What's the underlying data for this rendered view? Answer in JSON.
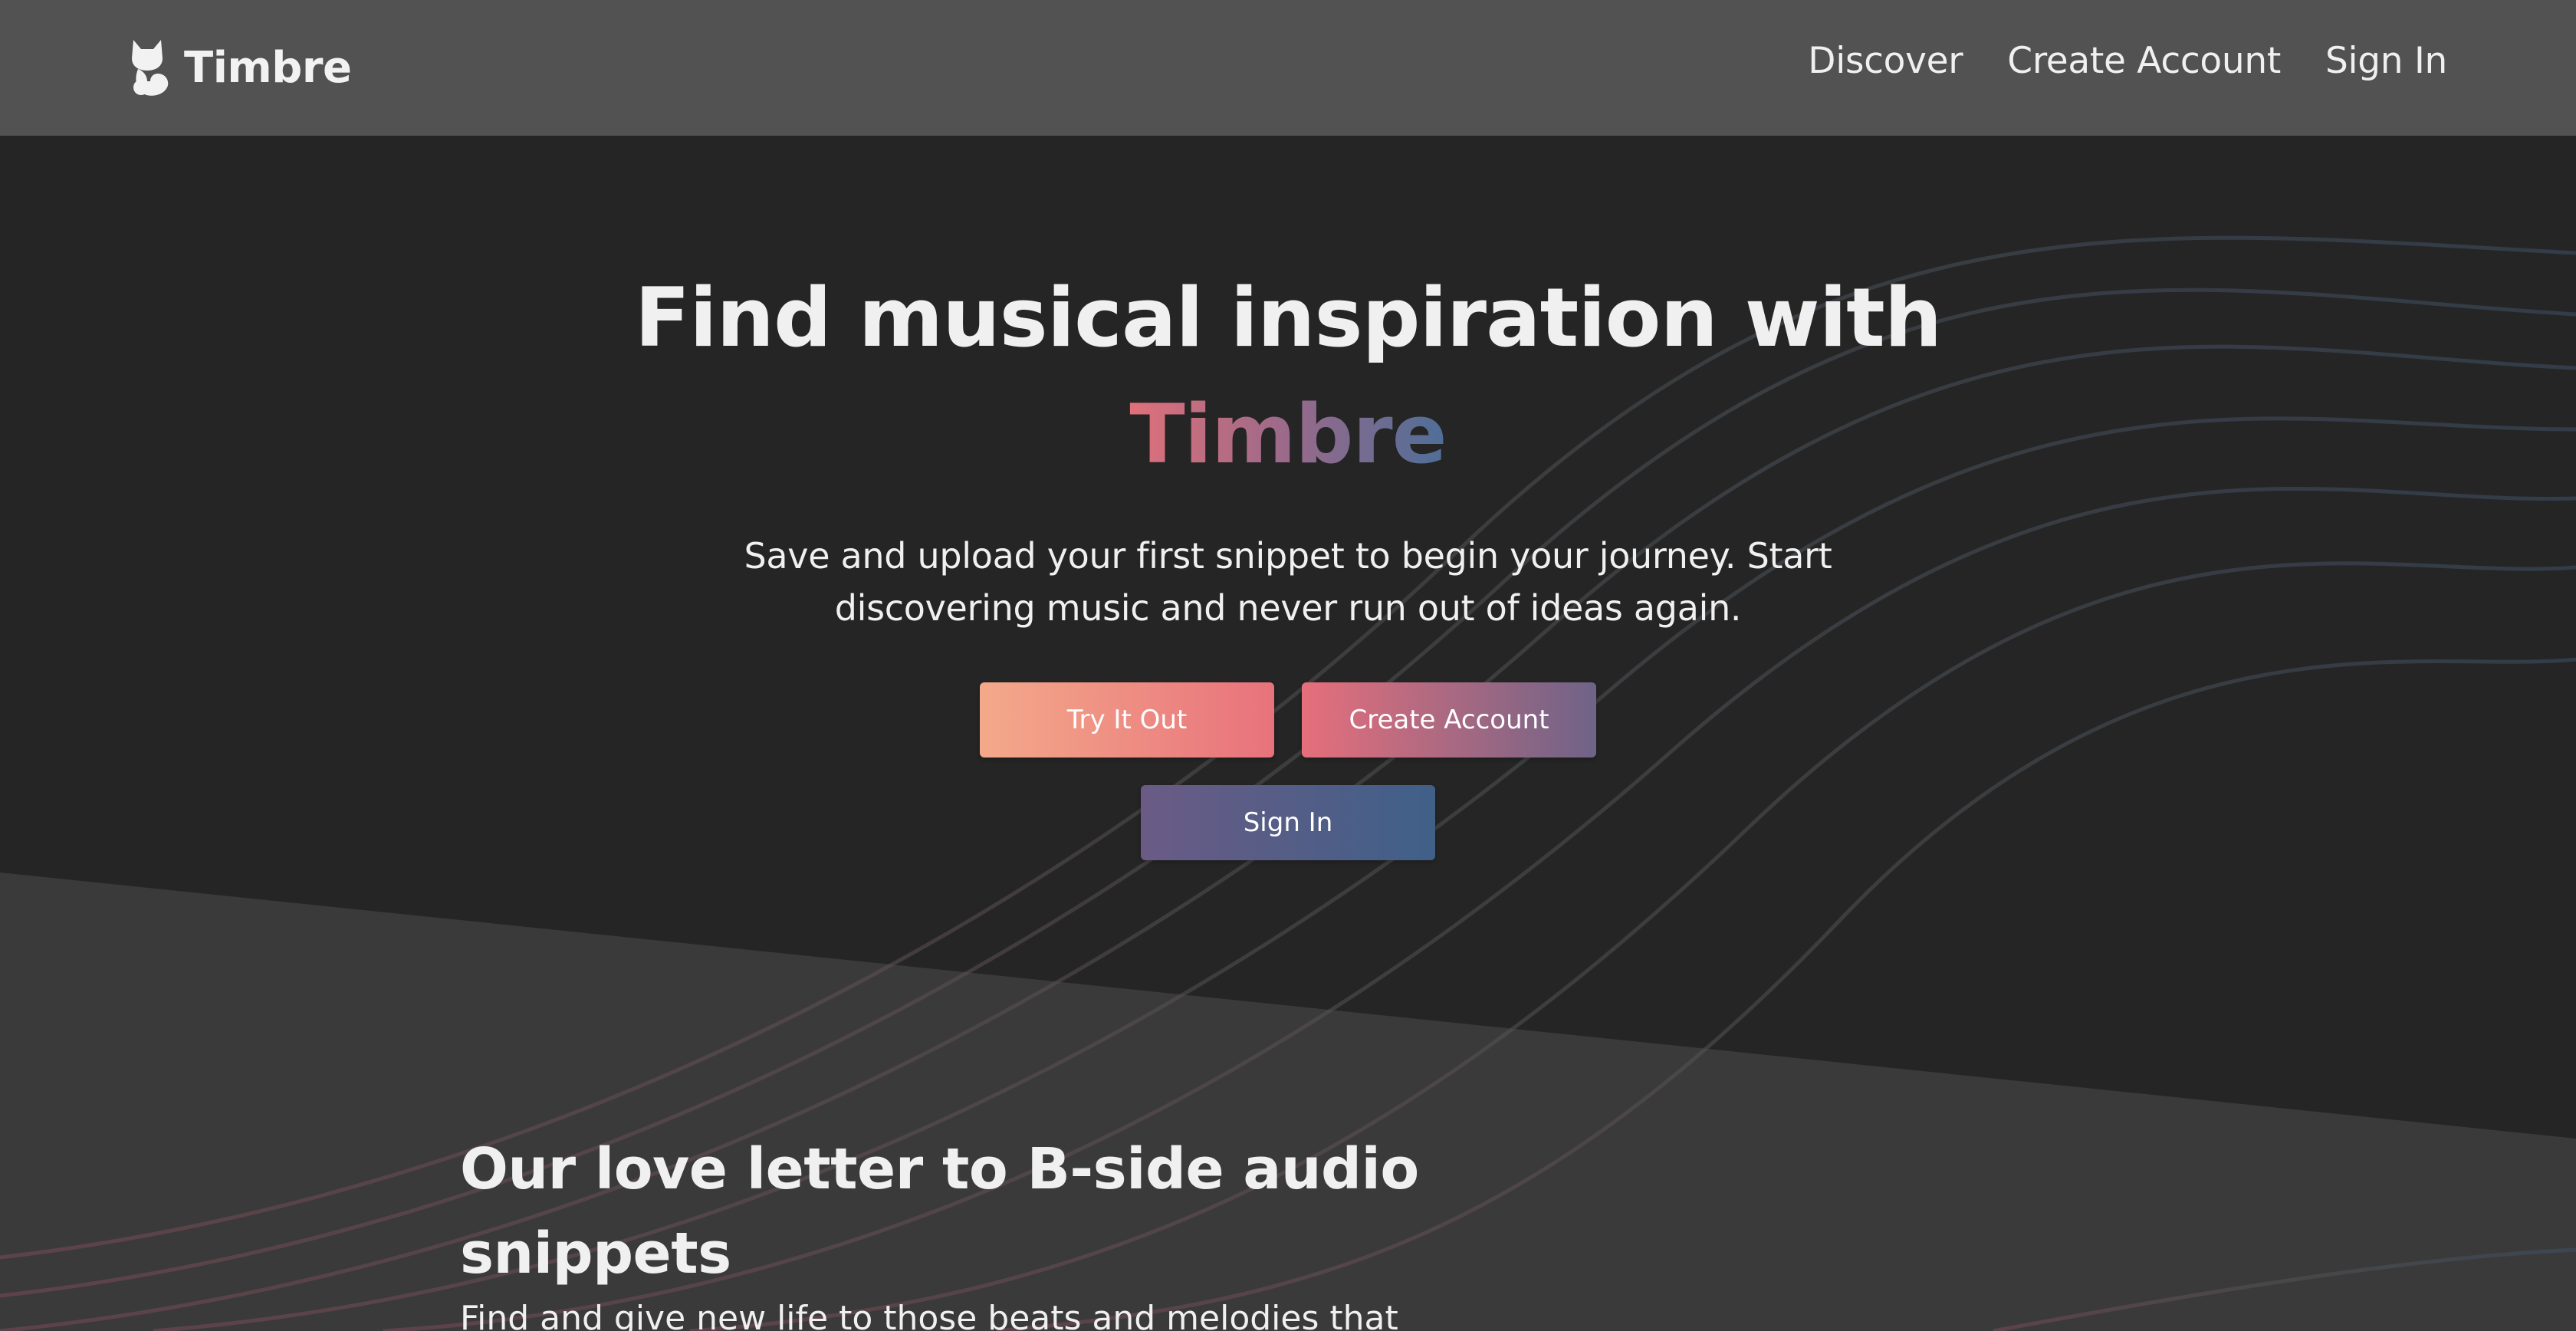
{
  "app": {
    "name": "Timbre"
  },
  "nav": {
    "brand_label": "Timbre",
    "logo_icon": "cat-music-note-icon",
    "links": [
      "Discover",
      "Create Account",
      "Sign In"
    ]
  },
  "hero": {
    "title_line1": "Find musical inspiration with",
    "title_brand": "Timbre",
    "subtitle_line1": "Save and upload your first snippet to begin your journey. Start",
    "subtitle_line2": "discovering music and never run out of ideas again.",
    "buttons": {
      "try": "Try It Out",
      "create": "Create Account",
      "signin": "Sign In"
    }
  },
  "section": {
    "title_line1": "Our love letter to B-side audio",
    "title_line2": "snippets",
    "text": "Find and give new life to those beats and melodies that"
  },
  "colors": {
    "nav_bg": "#525252",
    "hero_bg": "#252525",
    "lower_bg": "#3a3a3a",
    "gradient_pink": "#e8727c",
    "gradient_peach": "#f4a98a",
    "gradient_purple": "#6a5b85",
    "gradient_blue": "#3f6088"
  }
}
